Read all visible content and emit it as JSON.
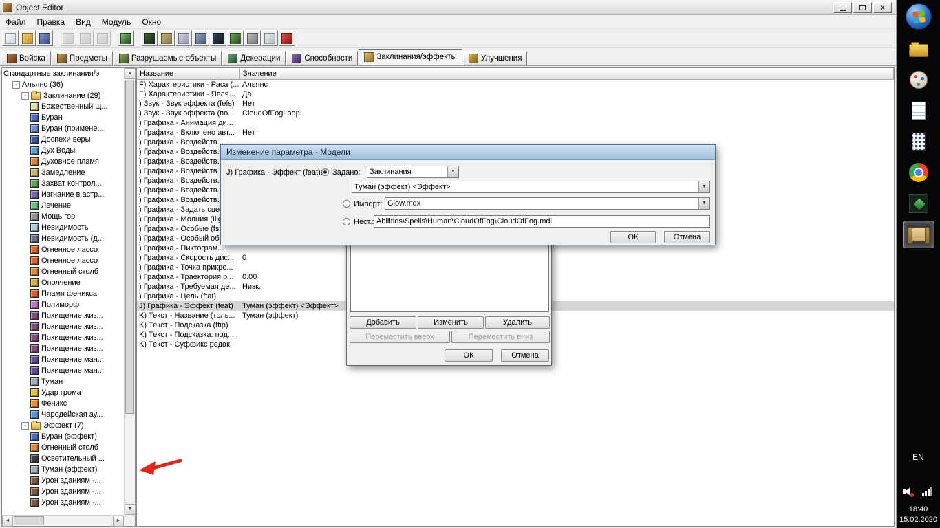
{
  "window": {
    "title": "Object Editor"
  },
  "menu": {
    "items": [
      "Файл",
      "Правка",
      "Вид",
      "Модуль",
      "Окно"
    ]
  },
  "toolbar": {
    "groups": [
      {
        "buttons": [
          {
            "name": "new-map-icon",
            "c1": "#ffffff",
            "c2": "#c8d0dc"
          },
          {
            "name": "open-map-icon",
            "c1": "#f8d878",
            "c2": "#c09030"
          },
          {
            "name": "save-map-icon",
            "c1": "#8098c8",
            "c2": "#3a4a78"
          }
        ]
      },
      {
        "buttons": [
          {
            "name": "undo-icon",
            "c1": "#d8d8d8",
            "c2": "#a0a0a0",
            "disabled": true
          },
          {
            "name": "redo-icon",
            "c1": "#d8d8d8",
            "c2": "#a0a0a0",
            "disabled": true
          },
          {
            "name": "copy-icon",
            "c1": "#d8d8d8",
            "c2": "#a0a0a0",
            "disabled": true
          }
        ]
      },
      {
        "buttons": [
          {
            "name": "test-map-icon",
            "c1": "#88c878",
            "c2": "#183818"
          }
        ]
      },
      {
        "buttons": [
          {
            "name": "terrain-editor-icon",
            "c1": "#486038",
            "c2": "#182810"
          },
          {
            "name": "trigger-editor-icon",
            "c1": "#c8b888",
            "c2": "#887848"
          },
          {
            "name": "sound-editor-icon",
            "c1": "#d8d8e8",
            "c2": "#9090b0"
          },
          {
            "name": "object-editor-icon",
            "c1": "#90a8c0",
            "c2": "#405870"
          },
          {
            "name": "campaign-editor-icon",
            "c1": "#304858",
            "c2": "#101820"
          },
          {
            "name": "ai-editor-icon",
            "c1": "#70a860",
            "c2": "#284818"
          },
          {
            "name": "object-manager-icon",
            "c1": "#c0c0c0",
            "c2": "#787878"
          },
          {
            "name": "import-manager-icon",
            "c1": "#f0f0f0",
            "c2": "#b0b8c0"
          },
          {
            "name": "test-map-red-icon",
            "c1": "#e05040",
            "c2": "#801810"
          }
        ]
      }
    ]
  },
  "tabs": {
    "items": [
      {
        "key": "units",
        "label": "Войска",
        "c1": "#b87840",
        "c2": "#603818"
      },
      {
        "key": "items",
        "label": "Предметы",
        "c1": "#c89850",
        "c2": "#6a4a20"
      },
      {
        "key": "destructibles",
        "label": "Разрушаемые объекты",
        "c1": "#88a858",
        "c2": "#3a5828"
      },
      {
        "key": "doodads",
        "label": "Декорации",
        "c1": "#68a870",
        "c2": "#284830"
      },
      {
        "key": "abilities",
        "label": "Способности",
        "c1": "#8868b0",
        "c2": "#402860"
      },
      {
        "key": "spells",
        "label": "Заклинания/эффекты",
        "c1": "#e0c870",
        "c2": "#907020",
        "active": true
      },
      {
        "key": "upgrades",
        "label": "Улучшения",
        "c1": "#d0b050",
        "c2": "#786018"
      }
    ]
  },
  "tree": {
    "nodes": [
      {
        "label": "Стандартные заклинания/э",
        "level": 0,
        "type": "root"
      },
      {
        "label": "Альянс (36)",
        "level": 1,
        "type": "group",
        "expanded": true
      },
      {
        "label": "Заклинание (29)",
        "level": 2,
        "type": "folder",
        "expanded": true
      },
      {
        "label": "Божественный щ...",
        "level": 3,
        "type": "leaf",
        "icon": "#e8dfa2"
      },
      {
        "label": "Буран",
        "level": 3,
        "type": "leaf",
        "icon": "#4a6cc4"
      },
      {
        "label": "Буран (примене...",
        "level": 3,
        "type": "leaf",
        "icon": "#6f8cd8"
      },
      {
        "label": "Доспехи веры",
        "level": 3,
        "type": "leaf",
        "icon": "#3a5aa8"
      },
      {
        "label": "Дух Воды",
        "level": 3,
        "type": "leaf",
        "icon": "#54a4d4"
      },
      {
        "label": "Духовное пламя",
        "level": 3,
        "type": "leaf",
        "icon": "#e08430"
      },
      {
        "label": "Замедление",
        "level": 3,
        "type": "leaf",
        "icon": "#c4b468"
      },
      {
        "label": "Захват контрол...",
        "level": 3,
        "type": "leaf",
        "icon": "#5ca452"
      },
      {
        "label": "Изгнание в астр...",
        "level": 3,
        "type": "leaf",
        "icon": "#7464b4"
      },
      {
        "label": "Лечение",
        "level": 3,
        "type": "leaf",
        "icon": "#64c484"
      },
      {
        "label": "Мощь гор",
        "level": 3,
        "type": "leaf",
        "icon": "#94949c"
      },
      {
        "label": "Невидимость",
        "level": 3,
        "type": "leaf",
        "icon": "#accce4"
      },
      {
        "label": "Невидимость (д...",
        "level": 3,
        "type": "leaf",
        "icon": "#64748c"
      },
      {
        "label": "Огненное лассо",
        "level": 3,
        "type": "leaf",
        "icon": "#e06424"
      },
      {
        "label": "Огненное лассо",
        "level": 3,
        "type": "leaf",
        "icon": "#e06424"
      },
      {
        "label": "Огненный столб",
        "level": 3,
        "type": "leaf",
        "icon": "#e88434"
      },
      {
        "label": "Ополчение",
        "level": 3,
        "type": "leaf",
        "icon": "#d4ac44"
      },
      {
        "label": "Пламя феникса",
        "level": 3,
        "type": "leaf",
        "icon": "#e45c1c"
      },
      {
        "label": "Полиморф",
        "level": 3,
        "type": "leaf",
        "icon": "#c474bc"
      },
      {
        "label": "Похищение жиз...",
        "level": 3,
        "type": "leaf",
        "icon": "#844c7c"
      },
      {
        "label": "Похищение жиз...",
        "level": 3,
        "type": "leaf",
        "icon": "#844c7c"
      },
      {
        "label": "Похищение жиз...",
        "level": 3,
        "type": "leaf",
        "icon": "#844c7c"
      },
      {
        "label": "Похищение жиз...",
        "level": 3,
        "type": "leaf",
        "icon": "#844c7c"
      },
      {
        "label": "Похищение ман...",
        "level": 3,
        "type": "leaf",
        "icon": "#644ca4"
      },
      {
        "label": "Похищение ман...",
        "level": 3,
        "type": "leaf",
        "icon": "#644ca4"
      },
      {
        "label": "Туман",
        "level": 3,
        "type": "leaf",
        "icon": "#9cacbc"
      },
      {
        "label": "Удар грома",
        "level": 3,
        "type": "leaf",
        "icon": "#e8c434"
      },
      {
        "label": "Феникс",
        "level": 3,
        "type": "leaf",
        "icon": "#f08c2c"
      },
      {
        "label": "Чародейская ау...",
        "level": 3,
        "type": "leaf",
        "icon": "#5c94dc"
      },
      {
        "label": "Эффект (7)",
        "level": 2,
        "type": "folder",
        "expanded": true
      },
      {
        "label": "Буран (эффект)",
        "level": 3,
        "type": "leaf",
        "icon": "#4a6cc4"
      },
      {
        "label": "Огненный столб",
        "level": 3,
        "type": "leaf",
        "icon": "#e88434"
      },
      {
        "label": "Осветительный ...",
        "level": 3,
        "type": "leaf",
        "icon": "#3c3c44"
      },
      {
        "label": "Туман (эффект)",
        "level": 3,
        "type": "leaf",
        "icon": "#9cacbc"
      },
      {
        "label": "Урон зданиям -...",
        "level": 3,
        "type": "leaf",
        "icon": "#7c5c3c"
      },
      {
        "label": "Урон зданиям -...",
        "level": 3,
        "type": "leaf",
        "icon": "#7c5c3c"
      },
      {
        "label": "Урон зданиям -...",
        "level": 3,
        "type": "leaf",
        "icon": "#7c5c3c"
      }
    ]
  },
  "grid": {
    "columns": [
      "Название",
      "Значение"
    ],
    "rows": [
      {
        "name": "F) Характеристики - Раса (...",
        "value": "Альянс"
      },
      {
        "name": "F) Характеристики - Явля...",
        "value": "Да"
      },
      {
        "name": ") Звук - Звук эффекта (fefs)",
        "value": "Нет"
      },
      {
        "name": ") Звук - Звук эффекта (по...",
        "value": "CloudOfFogLoop"
      },
      {
        "name": ") Графика - Анимация ди...",
        "value": ""
      },
      {
        "name": ") Графика - Включено авт...",
        "value": "Нет"
      },
      {
        "name": ") Графика - Воздейств...",
        "value": ""
      },
      {
        "name": ") Графика - Воздейств...",
        "value": ""
      },
      {
        "name": ") Графика - Воздейств...",
        "value": ""
      },
      {
        "name": ") Графика - Воздейств...",
        "value": ""
      },
      {
        "name": ") Графика - Воздейств...",
        "value": ""
      },
      {
        "name": ") Графика - Воздейств...",
        "value": ""
      },
      {
        "name": ") Графика - Воздейств...",
        "value": ""
      },
      {
        "name": ") Графика - Задать сце...",
        "value": ""
      },
      {
        "name": ") Графика - Молния (Ilig...",
        "value": ""
      },
      {
        "name": ") Графика - Особые (fsa...",
        "value": ""
      },
      {
        "name": ") Графика - Особый об...",
        "value": ""
      },
      {
        "name": ") Графика - Пиктограм...",
        "value": ""
      },
      {
        "name": ") Графика - Скорость дис...",
        "value": "0"
      },
      {
        "name": ") Графика - Точка прикре...",
        "value": ""
      },
      {
        "name": ") Графика - Траектория р...",
        "value": "0.00"
      },
      {
        "name": ") Графика - Требуемая де...",
        "value": "Низк."
      },
      {
        "name": ") Графика - Цель (ftat)",
        "value": ""
      },
      {
        "name": "J) Графика - Эффект (feat)",
        "value": "Туман (эффект) <Эффект>",
        "selected": true
      },
      {
        "name": "K) Текст - Название (толь...",
        "value": "Туман (эффект)"
      },
      {
        "name": "K) Текст - Подсказка (ftip)",
        "value": ""
      },
      {
        "name": "K) Текст - Подсказка: под...",
        "value": ""
      },
      {
        "name": "K) Текст - Суффикс редак...",
        "value": ""
      }
    ]
  },
  "bottom_dialog": {
    "add": "Добавить",
    "edit": "Изменить",
    "remove": "Удалить",
    "move_up": "Переместить вверх",
    "move_down": "Переместить вниз",
    "ok": "ОК",
    "cancel": "Отмена"
  },
  "top_dialog": {
    "title": "Изменение параметра  - Модели",
    "field_label": "J) Графика - Эффект (feat):",
    "preset_label": "Задано:",
    "preset_category": "Заклинания",
    "preset_value": "Туман (эффект) <Эффект>",
    "import_label": "Импорт:",
    "import_value": "Glow.mdx",
    "custom_label": "Нест.:",
    "custom_value": "Abilities\\Spells\\Human\\CloudOfFog\\CloudOfFog.mdl",
    "ok": "ОК",
    "cancel": "Отмена"
  },
  "taskbar": {
    "apps": [
      {
        "name": "explorer"
      },
      {
        "name": "paint"
      },
      {
        "name": "notepad"
      },
      {
        "name": "calculator"
      },
      {
        "name": "chrome"
      },
      {
        "name": "world-editor"
      },
      {
        "name": "object-editor",
        "active": true
      }
    ],
    "language": "EN",
    "time": "18:40",
    "date": "15.02.2020"
  }
}
